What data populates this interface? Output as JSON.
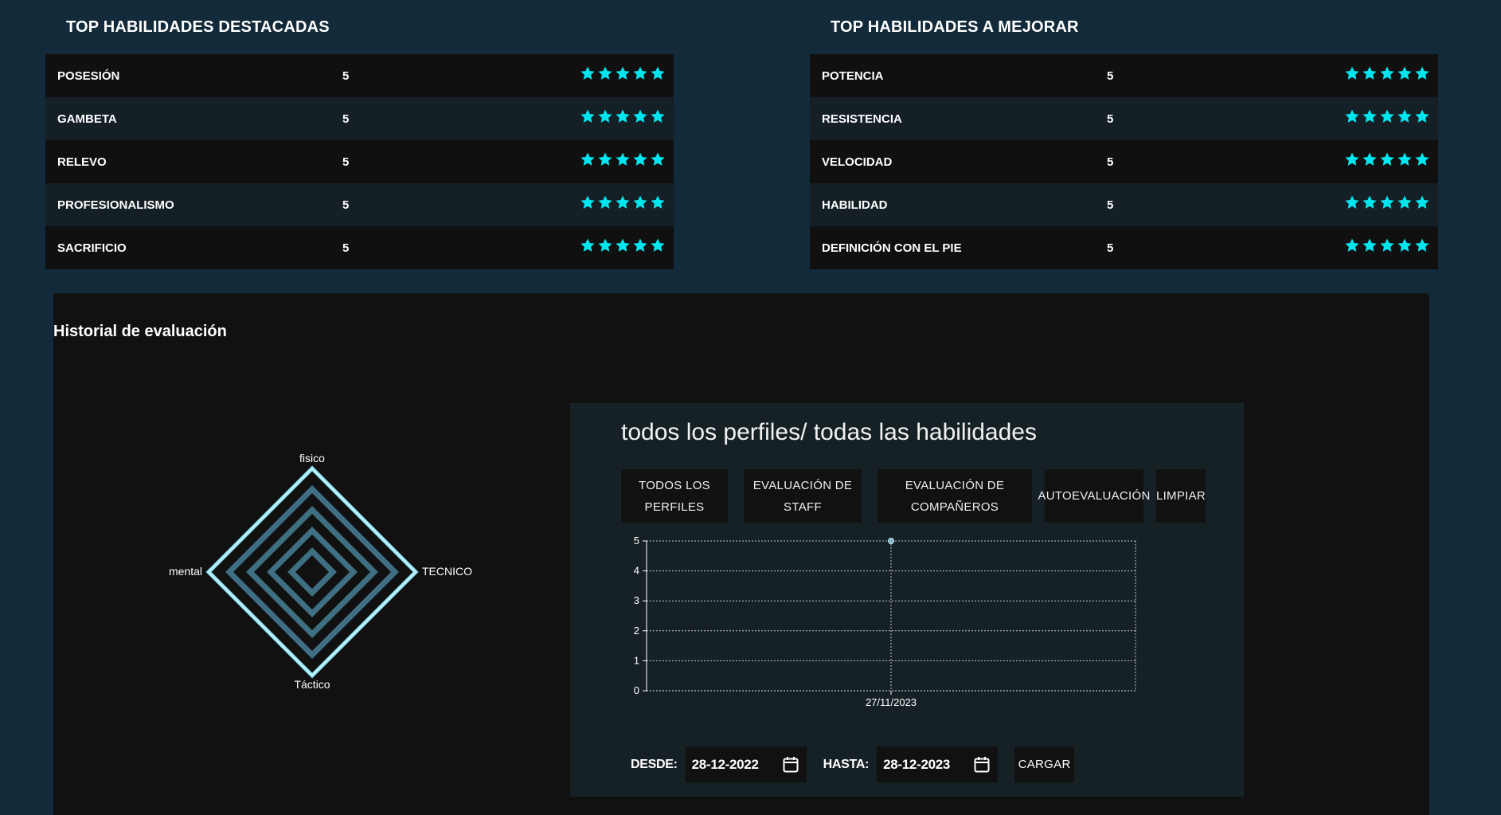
{
  "top_destacadas": {
    "title": "TOP HABILIDADES DESTACADAS",
    "rows": [
      {
        "name": "POSESIÓN",
        "score": "5",
        "stars": 5
      },
      {
        "name": "GAMBETA",
        "score": "5",
        "stars": 5
      },
      {
        "name": "RELEVO",
        "score": "5",
        "stars": 5
      },
      {
        "name": "PROFESIONALISMO",
        "score": "5",
        "stars": 5
      },
      {
        "name": "SACRIFICIO",
        "score": "5",
        "stars": 5
      }
    ]
  },
  "top_mejorar": {
    "title": "TOP HABILIDADES A MEJORAR",
    "rows": [
      {
        "name": "POTENCIA",
        "score": "5",
        "stars": 5
      },
      {
        "name": "RESISTENCIA",
        "score": "5",
        "stars": 5
      },
      {
        "name": "VELOCIDAD",
        "score": "5",
        "stars": 5
      },
      {
        "name": "HABILIDAD",
        "score": "5",
        "stars": 5
      },
      {
        "name": "DEFINICIÓN CON EL PIE",
        "score": "5",
        "stars": 5
      }
    ]
  },
  "colors": {
    "star": "#00e5ee",
    "radar_outer": "#8fe3f5",
    "radar_inner": "#3f6f82",
    "page_bg": "#132a3a"
  },
  "history": {
    "title": "Historial de evaluación"
  },
  "chart_data": [
    {
      "type": "radar",
      "axes": [
        "fisico",
        "TECNICO",
        "Táctico",
        "mental"
      ],
      "max": 5,
      "rings": 5,
      "series": [
        {
          "values": [
            5,
            5,
            5,
            5
          ]
        }
      ]
    },
    {
      "type": "line",
      "title": "todos los perfiles/ todas las habilidades",
      "categories": [
        "27/11/2023"
      ],
      "series": [
        {
          "values": [
            5
          ]
        }
      ],
      "ylim": [
        0,
        5
      ],
      "yticks": [
        0,
        1,
        2,
        3,
        4,
        5
      ],
      "grid": true
    }
  ],
  "filters": {
    "todos": "TODOS LOS PERFILES",
    "staff": "EVALUACIÓN DE STAFF",
    "companeros": "EVALUACIÓN DE COMPAÑEROS",
    "auto": "AUTOEVALUACIÓN",
    "limpiar": "LIMPIAR"
  },
  "date_filter": {
    "desde_label": "DESDE:",
    "desde_value": "28-12-2022",
    "hasta_label": "HASTA:",
    "hasta_value": "28-12-2023",
    "cargar_label": "CARGAR",
    "calendar_icon": "calendar-icon"
  }
}
